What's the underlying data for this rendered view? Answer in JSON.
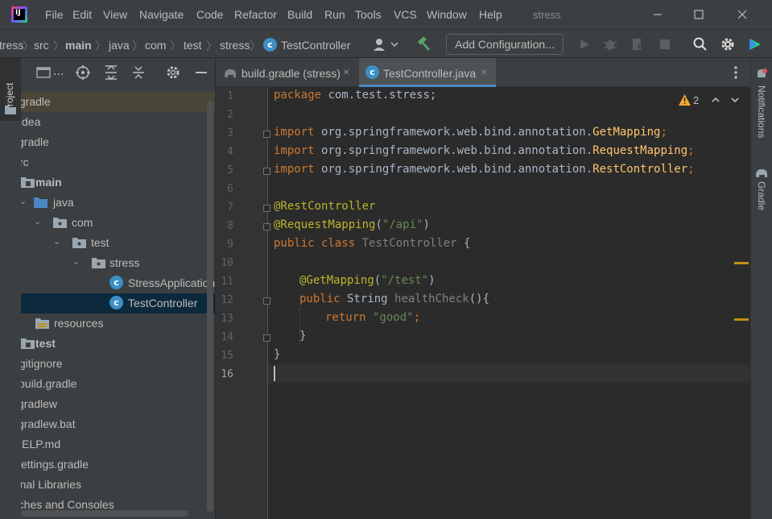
{
  "menu": [
    "File",
    "Edit",
    "View",
    "Navigate",
    "Code",
    "Refactor",
    "Build",
    "Run",
    "Tools",
    "VCS",
    "Window",
    "Help"
  ],
  "project_title": "stress",
  "breadcrumbs": [
    "stress",
    "src",
    "main",
    "java",
    "com",
    "test",
    "stress",
    "TestController"
  ],
  "add_configuration": "Add Configuration...",
  "left_tab": "Project",
  "panel_toolbar_collapsed": "...",
  "tree": [
    {
      "label": ".gradle"
    },
    {
      "label": ".idea"
    },
    {
      "label": "gradle"
    },
    {
      "label": "src"
    },
    {
      "label": "main"
    },
    {
      "label": "java"
    },
    {
      "label": "com"
    },
    {
      "label": "test"
    },
    {
      "label": "stress"
    },
    {
      "label": "StressApplication"
    },
    {
      "label": "TestController"
    },
    {
      "label": "resources"
    },
    {
      "label": "test"
    },
    {
      "label": ".gitignore"
    },
    {
      "label": "build.gradle"
    },
    {
      "label": "gradlew"
    },
    {
      "label": "gradlew.bat"
    },
    {
      "label": "HELP.md"
    },
    {
      "label": "settings.gradle"
    },
    {
      "label": "External Libraries"
    },
    {
      "label": "Scratches and Consoles"
    }
  ],
  "tabs": [
    {
      "label": "build.gradle (stress)",
      "close": "×"
    },
    {
      "label": "TestController.java",
      "close": "×"
    }
  ],
  "editor": {
    "line_numbers": [
      "1",
      "2",
      "3",
      "4",
      "5",
      "6",
      "7",
      "8",
      "9",
      "10",
      "11",
      "12",
      "13",
      "14",
      "15",
      "16"
    ],
    "warning_count": "2",
    "code": {
      "l1_kw": "package",
      "l1_rest": " com.test.stress;",
      "import_kw": "import",
      "l3_pkg": " org.springframework.web.bind.annotation.",
      "l3_cls": "GetMapping",
      "l3_end": ";",
      "l4_pkg": " org.springframework.web.bind.annotation.",
      "l4_cls": "RequestMapping",
      "l4_end": ";",
      "l5_pkg": " org.springframework.web.bind.annotation.",
      "l5_cls": "RestController",
      "l5_end": ";",
      "l7_ann": "@RestController",
      "l8_ann": "@RequestMapping",
      "l8_open": "(",
      "l8_str": "\"/api\"",
      "l8_close": ")",
      "l9_kw": "public class",
      "l9_cls": " TestController",
      "l9_end": " {",
      "l11_ann": "@GetMapping",
      "l11_open": "(",
      "l11_str": "\"/test\"",
      "l11_close": ")",
      "l12_kw": "public",
      "l12_type": " String",
      "l12_fn": " healthCheck",
      "l12_end": "(){",
      "l13_kw": "return",
      "l13_str": " \"good\"",
      "l13_end": ";",
      "l14": "}",
      "l15": "}"
    }
  },
  "right_tabs": [
    "Notifications",
    "Gradle"
  ],
  "colors": {
    "keyword": "#cc7832",
    "annotation": "#bbb529",
    "string": "#6a8759",
    "accent": "#4a88c7"
  }
}
